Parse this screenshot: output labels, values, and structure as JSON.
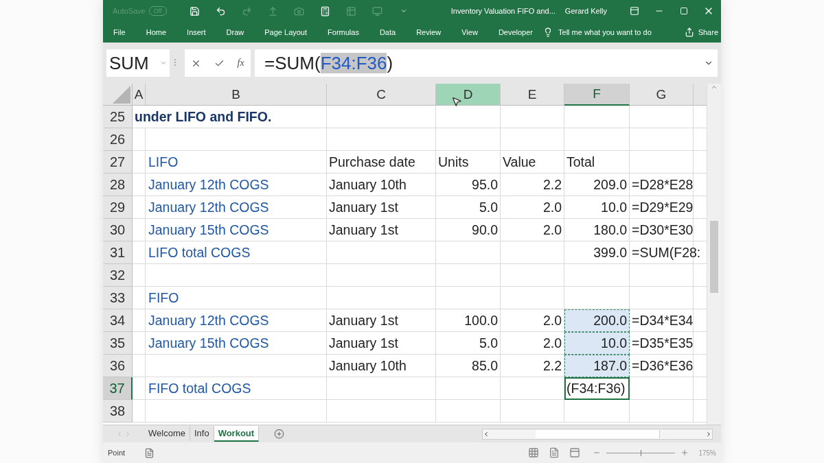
{
  "title_bar": {
    "autosave_label": "AutoSave",
    "autosave_state": "Off",
    "document_title": "Inventory Valuation FIFO and...",
    "user": "Gerard Kelly"
  },
  "ribbon_tabs": [
    {
      "label": "File"
    },
    {
      "label": "Home"
    },
    {
      "label": "Insert"
    },
    {
      "label": "Draw"
    },
    {
      "label": "Page Layout"
    },
    {
      "label": "Formulas"
    },
    {
      "label": "Data"
    },
    {
      "label": "Review"
    },
    {
      "label": "View"
    },
    {
      "label": "Developer"
    }
  ],
  "tell_me": {
    "placeholder": "Tell me what you want to do"
  },
  "share": "Share",
  "formula_bar": {
    "name_box": "SUM",
    "function_button": "fx",
    "formula_prefix": "=SUM(",
    "formula_reference": "F34:F36",
    "formula_suffix": ")"
  },
  "columns": [
    {
      "label": "A",
      "selected": false,
      "hovered": false
    },
    {
      "label": "B",
      "selected": false,
      "hovered": false
    },
    {
      "label": "C",
      "selected": false,
      "hovered": false
    },
    {
      "label": "D",
      "selected": false,
      "hovered": true
    },
    {
      "label": "E",
      "selected": false,
      "hovered": false
    },
    {
      "label": "F",
      "selected": true,
      "hovered": false
    },
    {
      "label": "G",
      "selected": false,
      "hovered": false
    }
  ],
  "rows": [
    {
      "number": "25",
      "selected": false,
      "cells": {
        "a": {
          "kind": "heading",
          "text": "under LIFO and FIFO.",
          "in_range": false,
          "active": false
        }
      }
    },
    {
      "number": "26",
      "selected": false
    },
    {
      "number": "27",
      "selected": false,
      "cells": {
        "b": {
          "kind": "label",
          "text": "LIFO",
          "in_range": false,
          "active": false
        },
        "c": {
          "kind": "text",
          "text": "Purchase date",
          "in_range": false,
          "active": false
        },
        "d": {
          "kind": "text",
          "text": "Units",
          "in_range": false,
          "active": false
        },
        "e": {
          "kind": "text",
          "text": "Value",
          "in_range": false,
          "active": false
        },
        "f": {
          "kind": "text",
          "text": "Total",
          "in_range": false,
          "active": false
        }
      }
    },
    {
      "number": "28",
      "selected": false,
      "cells": {
        "b": {
          "kind": "label",
          "text": "January 12th COGS",
          "in_range": false,
          "active": false
        },
        "c": {
          "kind": "text",
          "text": "January 10th",
          "in_range": false,
          "active": false
        },
        "d": {
          "kind": "number",
          "text": "95.0",
          "in_range": false,
          "active": false
        },
        "e": {
          "kind": "number",
          "text": "2.2",
          "in_range": false,
          "active": false
        },
        "f": {
          "kind": "number",
          "text": "209.0",
          "in_range": false,
          "active": false
        },
        "g": {
          "kind": "text",
          "text": "=D28*E28",
          "in_range": false,
          "active": false
        }
      }
    },
    {
      "number": "29",
      "selected": false,
      "cells": {
        "b": {
          "kind": "label",
          "text": "January 12th COGS",
          "in_range": false,
          "active": false
        },
        "c": {
          "kind": "text",
          "text": "January 1st",
          "in_range": false,
          "active": false
        },
        "d": {
          "kind": "number",
          "text": "5.0",
          "in_range": false,
          "active": false
        },
        "e": {
          "kind": "number",
          "text": "2.0",
          "in_range": false,
          "active": false
        },
        "f": {
          "kind": "number",
          "text": "10.0",
          "in_range": false,
          "active": false
        },
        "g": {
          "kind": "text",
          "text": "=D29*E29",
          "in_range": false,
          "active": false
        }
      }
    },
    {
      "number": "30",
      "selected": false,
      "cells": {
        "b": {
          "kind": "label",
          "text": "January 15th COGS",
          "in_range": false,
          "active": false
        },
        "c": {
          "kind": "text",
          "text": "January 1st",
          "in_range": false,
          "active": false
        },
        "d": {
          "kind": "number",
          "text": "90.0",
          "in_range": false,
          "active": false
        },
        "e": {
          "kind": "number",
          "text": "2.0",
          "in_range": false,
          "active": false
        },
        "f": {
          "kind": "number",
          "text": "180.0",
          "in_range": false,
          "active": false
        },
        "g": {
          "kind": "text",
          "text": "=D30*E30",
          "in_range": false,
          "active": false
        }
      }
    },
    {
      "number": "31",
      "selected": false,
      "cells": {
        "b": {
          "kind": "label",
          "text": "LIFO total COGS",
          "in_range": false,
          "active": false
        },
        "f": {
          "kind": "number",
          "text": "399.0",
          "in_range": false,
          "active": false
        },
        "g": {
          "kind": "text",
          "text": "=SUM(F28:",
          "in_range": false,
          "active": false
        }
      }
    },
    {
      "number": "32",
      "selected": false
    },
    {
      "number": "33",
      "selected": false,
      "cells": {
        "b": {
          "kind": "label",
          "text": "FIFO",
          "in_range": false,
          "active": false
        }
      }
    },
    {
      "number": "34",
      "selected": false,
      "cells": {
        "b": {
          "kind": "label",
          "text": "January 12th COGS",
          "in_range": false,
          "active": false
        },
        "c": {
          "kind": "text",
          "text": "January 1st",
          "in_range": false,
          "active": false
        },
        "d": {
          "kind": "number",
          "text": "100.0",
          "in_range": false,
          "active": false
        },
        "e": {
          "kind": "number",
          "text": "2.0",
          "in_range": false,
          "active": false
        },
        "f": {
          "kind": "number",
          "text": "200.0",
          "in_range": true,
          "active": false
        },
        "g": {
          "kind": "text",
          "text": "=D34*E34",
          "in_range": false,
          "active": false
        }
      }
    },
    {
      "number": "35",
      "selected": false,
      "cells": {
        "b": {
          "kind": "label",
          "text": "January 15th COGS",
          "in_range": false,
          "active": false
        },
        "c": {
          "kind": "text",
          "text": "January 1st",
          "in_range": false,
          "active": false
        },
        "d": {
          "kind": "number",
          "text": "5.0",
          "in_range": false,
          "active": false
        },
        "e": {
          "kind": "number",
          "text": "2.0",
          "in_range": false,
          "active": false
        },
        "f": {
          "kind": "number",
          "text": "10.0",
          "in_range": true,
          "active": false
        },
        "g": {
          "kind": "text",
          "text": "=D35*E35",
          "in_range": false,
          "active": false
        }
      }
    },
    {
      "number": "36",
      "selected": false,
      "cells": {
        "c": {
          "kind": "text",
          "text": "January 10th",
          "in_range": false,
          "active": false
        },
        "d": {
          "kind": "number",
          "text": "85.0",
          "in_range": false,
          "active": false
        },
        "e": {
          "kind": "number",
          "text": "2.2",
          "in_range": false,
          "active": false
        },
        "f": {
          "kind": "number",
          "text": "187.0",
          "in_range": true,
          "active": false
        },
        "g": {
          "kind": "text",
          "text": "=D36*E36",
          "in_range": false,
          "active": false
        }
      }
    },
    {
      "number": "37",
      "selected": true,
      "cells": {
        "b": {
          "kind": "label",
          "text": "FIFO total COGS",
          "in_range": false,
          "active": false
        },
        "f": {
          "kind": "text",
          "text": "(F34:F36)",
          "in_range": false,
          "active": true
        }
      }
    },
    {
      "number": "38",
      "selected": false
    }
  ],
  "sheet_tabs": [
    {
      "label": "Welcome",
      "selected": false
    },
    {
      "label": "Info",
      "selected": false
    },
    {
      "label": "Workout",
      "selected": true
    }
  ],
  "status_bar": {
    "mode": "Point",
    "zoom": "175%",
    "zoom_level": {
      "level": 0.5
    }
  }
}
